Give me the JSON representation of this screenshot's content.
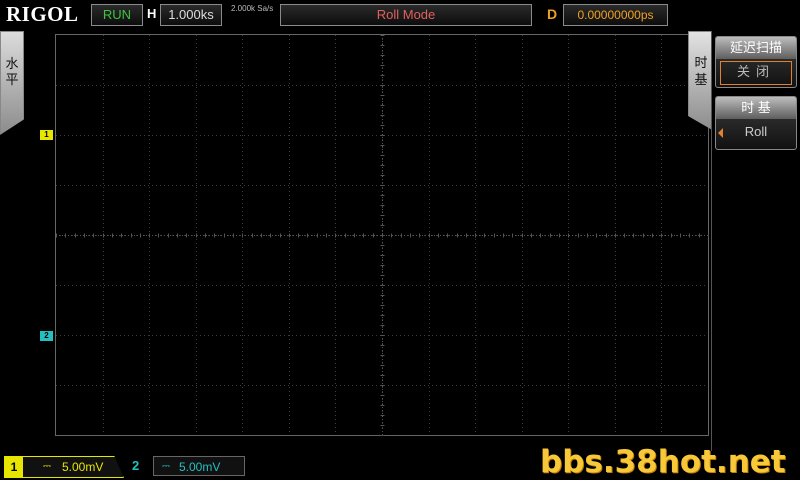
{
  "top": {
    "logo": "RIGOL",
    "status": "RUN",
    "h_label": "H",
    "h_value": "1.000ks",
    "sample_rate": "2.000k Sa/s",
    "mode": "Roll Mode",
    "d_label": "D",
    "d_value": "0.00000000ps"
  },
  "left_tab": {
    "label": "水\n平"
  },
  "right_tab": {
    "label": "时\n基"
  },
  "menu": {
    "delay_scan": {
      "title": "延迟扫描",
      "value": "关闭"
    },
    "timebase": {
      "title": "时 基",
      "value": "Roll"
    }
  },
  "channels": {
    "ch1": {
      "marker": "1",
      "number": "1",
      "coupling": "⎓",
      "scale": "5.00mV",
      "color": "#e6e600"
    },
    "ch2": {
      "marker": "2",
      "number": "2",
      "coupling": "⎓",
      "scale": "5.00mV",
      "color": "#24c0c0"
    }
  },
  "watermark": "bbs.38hot.net",
  "colors": {
    "run": "#3ec43e",
    "mode": "#e06060",
    "delay": "#f0a020"
  }
}
